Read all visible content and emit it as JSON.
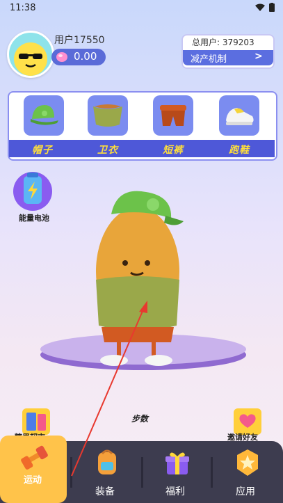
{
  "status_bar": {
    "time": "11:38"
  },
  "profile": {
    "username": "用户17550",
    "coins": "0.00"
  },
  "stats": {
    "total_users": "总用户: 379203",
    "mechanism_label": "减产机制",
    "mechanism_arrow": ">"
  },
  "equipment": [
    {
      "label": "帽子",
      "icon": "green-cap-icon"
    },
    {
      "label": "卫衣",
      "icon": "hoodie-icon"
    },
    {
      "label": "短裤",
      "icon": "shorts-icon"
    },
    {
      "label": "跑鞋",
      "icon": "sneaker-icon"
    }
  ],
  "energy": {
    "label": "能量电池"
  },
  "steps": {
    "title": "步数"
  },
  "side_buttons": {
    "left_label": "糖果超市",
    "right_label": "邀请好友"
  },
  "tabs": [
    {
      "label": "运动",
      "icon": "dumbbell-icon",
      "active": true
    },
    {
      "label": "装备",
      "icon": "backpack-icon",
      "active": false
    },
    {
      "label": "福利",
      "icon": "gift-icon",
      "active": false
    },
    {
      "label": "应用",
      "icon": "star-badge-icon",
      "active": false
    }
  ],
  "colors": {
    "accent": "#5b6ee0",
    "label_yellow": "#ffdf3a",
    "tabbar": "#3d3c4f",
    "active_tab": "#ffc34a",
    "annotation_arrow": "#e8392f"
  }
}
